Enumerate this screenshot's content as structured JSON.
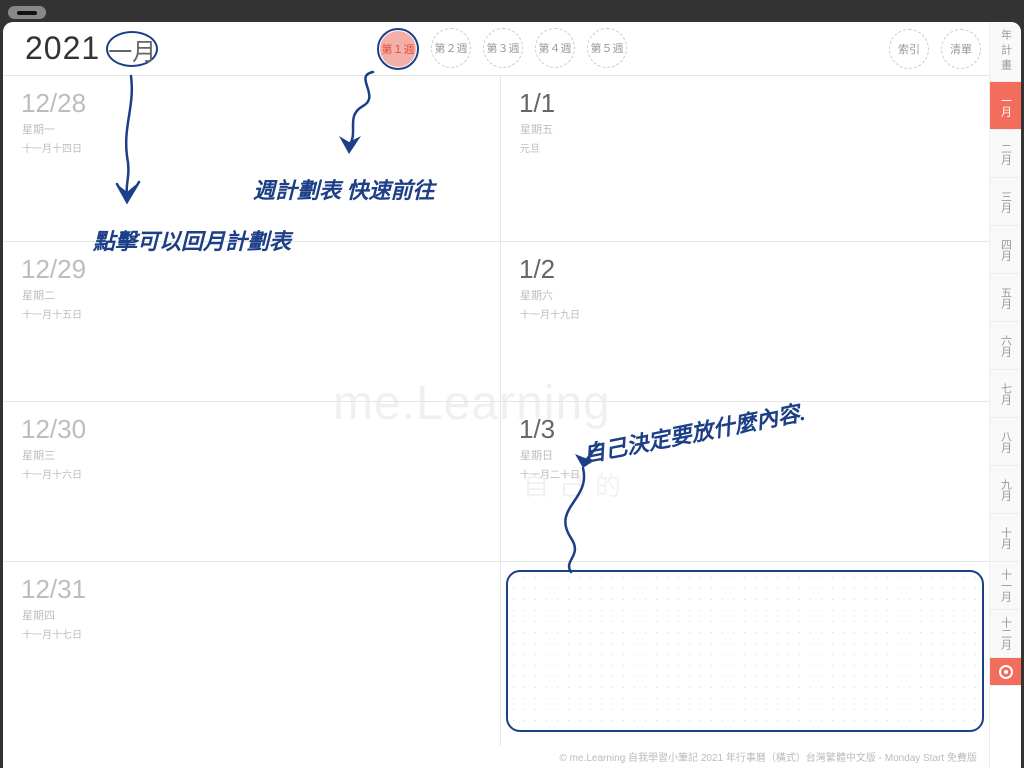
{
  "header": {
    "year": "2021",
    "month": "一月",
    "weeks": [
      "第１週",
      "第２週",
      "第３週",
      "第４週",
      "第５週"
    ],
    "active_week_index": 0,
    "right_buttons": [
      "索引",
      "清單"
    ]
  },
  "sidebar": {
    "annual": "年計畫",
    "months": [
      "一月",
      "二月",
      "三月",
      "四月",
      "五月",
      "六月",
      "七月",
      "八月",
      "九月",
      "十月",
      "十一月",
      "十二月"
    ],
    "active_month_index": 0
  },
  "days_left": [
    {
      "date": "12/28",
      "dow": "星期一",
      "lunar": "十一月十四日"
    },
    {
      "date": "12/29",
      "dow": "星期二",
      "lunar": "十一月十五日"
    },
    {
      "date": "12/30",
      "dow": "星期三",
      "lunar": "十一月十六日"
    },
    {
      "date": "12/31",
      "dow": "星期四",
      "lunar": "十一月十七日"
    }
  ],
  "days_right": [
    {
      "date": "1/1",
      "dow": "星期五",
      "lunar": "元旦",
      "dark": true
    },
    {
      "date": "1/2",
      "dow": "星期六",
      "lunar": "十一月十九日",
      "dark": true
    },
    {
      "date": "1/3",
      "dow": "星期日",
      "lunar": "十一月二十日",
      "dark": true
    }
  ],
  "annotations": {
    "a1": "點擊可以回月計劃表",
    "a2": "週計劃表 快速前往",
    "a3": "自己決定要放什麼內容."
  },
  "watermark": {
    "line1": "me.Learning",
    "line2": "自己的"
  },
  "footer": "© me.Learning 自我學習小筆記 2021 年行事曆（橫式）台灣繁體中文版 - Monday Start 免費版"
}
